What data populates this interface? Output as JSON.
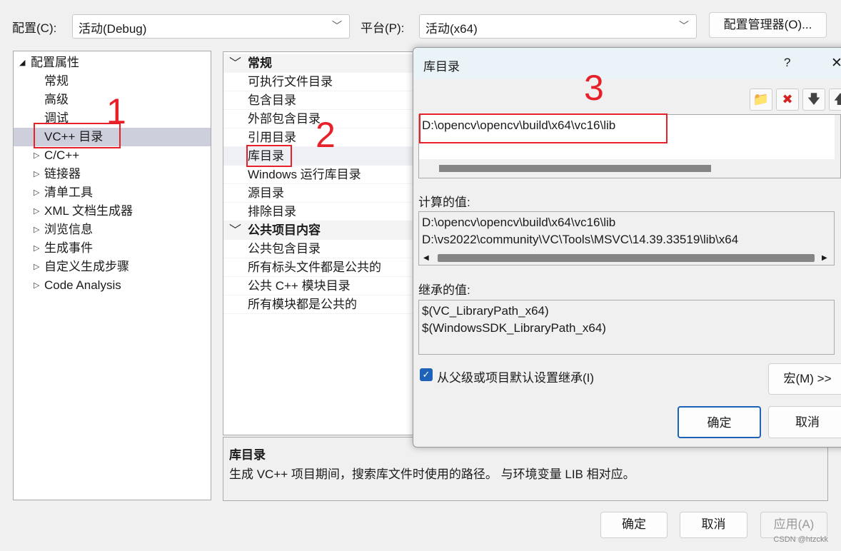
{
  "top": {
    "config_label": "配置(C):",
    "config_value": "活动(Debug)",
    "platform_label": "平台(P):",
    "platform_value": "活动(x64)",
    "config_manager": "配置管理器(O)..."
  },
  "tree": {
    "root": "配置属性",
    "items": [
      {
        "label": "常规",
        "expandable": false
      },
      {
        "label": "高级",
        "expandable": false
      },
      {
        "label": "调试",
        "expandable": false
      },
      {
        "label": "VC++ 目录",
        "expandable": false,
        "selected": true
      },
      {
        "label": "C/C++",
        "expandable": true
      },
      {
        "label": "链接器",
        "expandable": true
      },
      {
        "label": "清单工具",
        "expandable": true
      },
      {
        "label": "XML 文档生成器",
        "expandable": true
      },
      {
        "label": "浏览信息",
        "expandable": true
      },
      {
        "label": "生成事件",
        "expandable": true
      },
      {
        "label": "自定义生成步骤",
        "expandable": true
      },
      {
        "label": "Code Analysis",
        "expandable": true
      }
    ]
  },
  "grid": {
    "categories": [
      {
        "label": "常规",
        "items": [
          "可执行文件目录",
          "包含目录",
          "外部包含目录",
          "引用目录",
          "库目录",
          "Windows 运行库目录",
          "源目录",
          "排除目录"
        ]
      },
      {
        "label": "公共项目内容",
        "items": [
          "公共包含目录",
          "所有标头文件都是公共的",
          "公共 C++ 模块目录",
          "所有模块都是公共的"
        ]
      }
    ]
  },
  "description": {
    "title": "库目录",
    "text": "生成 VC++ 项目期间，搜索库文件时使用的路径。 与环境变量 LIB 相对应。"
  },
  "buttons": {
    "ok": "确定",
    "cancel": "取消",
    "apply": "应用(A)"
  },
  "dialog": {
    "title": "库目录",
    "help": "?",
    "close": "✕",
    "entries": [
      "D:\\opencv\\opencv\\build\\x64\\vc16\\lib"
    ],
    "computed_label": "计算的值:",
    "computed": [
      "D:\\opencv\\opencv\\build\\x64\\vc16\\lib",
      "D:\\vs2022\\community\\VC\\Tools\\MSVC\\14.39.33519\\lib\\x64"
    ],
    "inherited_label": "继承的值:",
    "inherited": [
      "$(VC_LibraryPath_x64)",
      "$(WindowsSDK_LibraryPath_x64)"
    ],
    "inherit_checkbox": "从父级或项目默认设置继承(I)",
    "inherit_checked": true,
    "macros": "宏(M) >>",
    "ok": "确定",
    "cancel": "取消"
  },
  "annotations": [
    "1",
    "2",
    "3"
  ],
  "watermark": "CSDN @htzckk"
}
